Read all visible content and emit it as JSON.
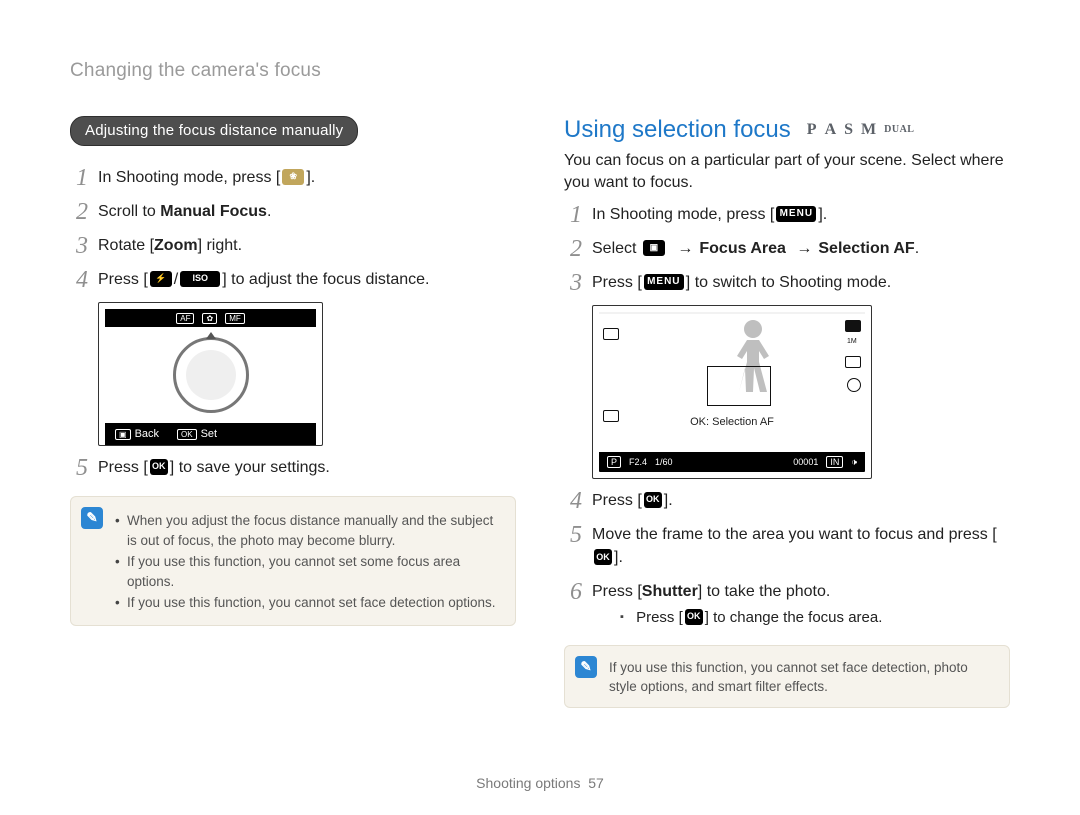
{
  "running_head": "Changing the camera's focus",
  "left": {
    "pill": "Adjusting the focus distance manually",
    "steps": {
      "1": {
        "pre": "In Shooting mode, press [",
        "post": "]."
      },
      "2": {
        "pre": "Scroll to ",
        "bold": "Manual Focus",
        "post": "."
      },
      "3": {
        "pre": "Rotate [",
        "bold": "Zoom",
        "post": "] right."
      },
      "4": {
        "pre": "Press [",
        "mid": "/",
        "post": "] to adjust the focus distance."
      },
      "5": {
        "pre": "Press [",
        "post": "] to save your settings."
      }
    },
    "lcd": {
      "top": {
        "a": "AF",
        "b": "✿",
        "c": "MF"
      },
      "back_key": "▣",
      "back": "Back",
      "set_key": "OK",
      "set": "Set"
    },
    "notes": [
      "When you adjust the focus distance manually and the subject is out of focus, the photo may become blurry.",
      "If you use this function, you cannot set some focus area options.",
      "If you use this function, you cannot set face detection options."
    ]
  },
  "right": {
    "title": "Using selection focus",
    "modes": [
      "P",
      "A",
      "S",
      "M"
    ],
    "modes_suffix": "DUAL",
    "lead": "You can focus on a particular part of your scene. Select where you want to focus.",
    "steps": {
      "1": {
        "pre": "In Shooting mode, press [",
        "menu": "MENU",
        "post": "]."
      },
      "2": {
        "pre": "Select ",
        "arrow": "→",
        "b1": "Focus Area",
        "b2": "Selection AF",
        "post": "."
      },
      "3": {
        "pre": "Press [",
        "menu": "MENU",
        "post": "] to switch to Shooting mode."
      },
      "4": {
        "pre": "Press [",
        "post": "]."
      },
      "5": {
        "text": "Move the frame to the area you want to focus and press [",
        "post": "]."
      },
      "6": {
        "pre": "Press [",
        "bold": "Shutter",
        "post": "] to take the photo."
      }
    },
    "sub6": "Press [    ] to change the focus area.",
    "lcd": {
      "ok_line": "OK: Selection AF",
      "status": {
        "mode": "P",
        "f": "F2.4",
        "sh": "1/60",
        "ev": "",
        "count": "00001",
        "mem": "IN"
      },
      "r2": "1M"
    },
    "note": "If you use this function, you cannot set face detection, photo style options, and smart filter effects."
  },
  "footer": {
    "section": "Shooting options",
    "page": "57"
  },
  "icons": {
    "macro": "flower-icon",
    "flash": "flash-icon",
    "iso": "ISO",
    "ok_menu": "ok-menu-icon",
    "film": "film-icon",
    "menu": "MENU",
    "camera": "camera-icon"
  }
}
